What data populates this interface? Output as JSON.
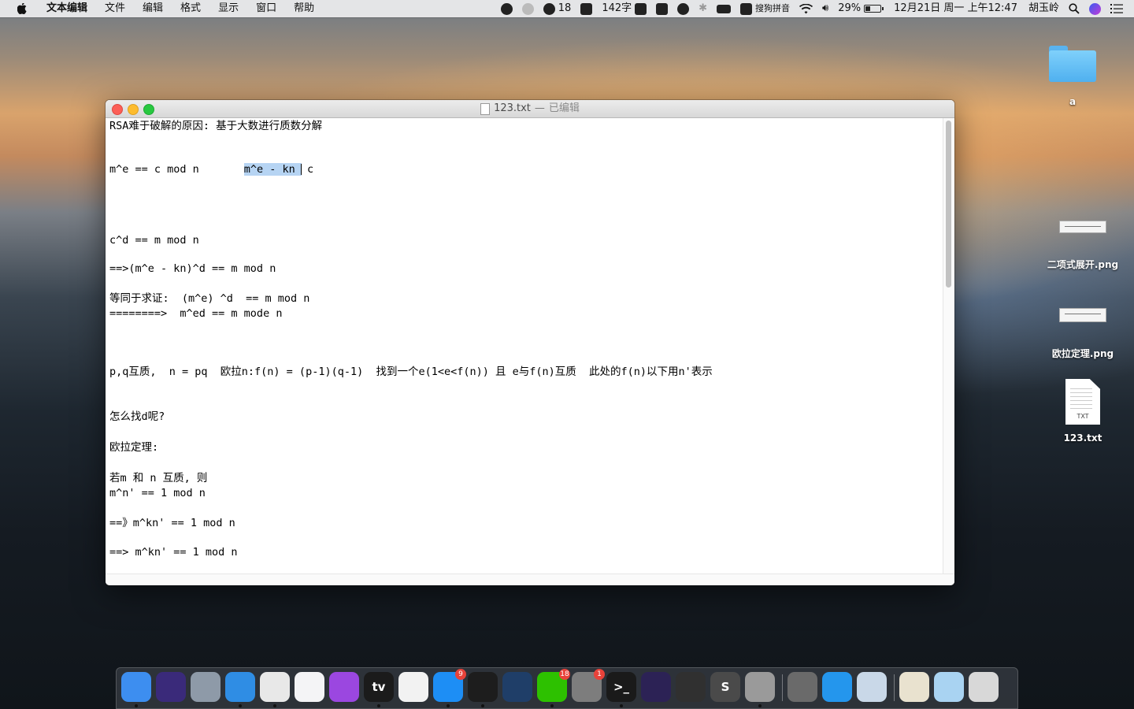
{
  "menubar": {
    "app_name": "文本编辑",
    "menus": [
      "文件",
      "编辑",
      "格式",
      "显示",
      "窗口",
      "帮助"
    ],
    "status": {
      "wechat_count": "18",
      "word_count": "142字",
      "input_method": "搜狗拼音",
      "battery": "29%",
      "datetime": "12月21日 周一 上午12:47",
      "user": "胡玉岭"
    }
  },
  "desktop": {
    "icons": [
      {
        "label": "a",
        "type": "folder-icon"
      },
      {
        "label": "二项式展开.png",
        "type": "image-thumbnail-icon"
      },
      {
        "label": "欧拉定理.png",
        "type": "image-thumbnail-icon"
      },
      {
        "label": "123.txt",
        "type": "text-file-icon",
        "badge": "TXT"
      }
    ]
  },
  "window": {
    "filename": "123.txt",
    "separator": "—",
    "state": "已编辑",
    "lines": [
      {
        "text": "RSA难于破解的原因: 基于大数进行质数分解"
      },
      {
        "pre": "m^e == c mod n       ",
        "selected": "m^e - kn ",
        "post": " c"
      },
      {
        "text": "c^d == m mod n"
      },
      {
        "text": "==>(m^e - kn)^d == m mod n"
      },
      {
        "text": "等同于求证:  (m^e) ^d  == m mod n"
      },
      {
        "text": "========>  m^ed == m mode n"
      },
      {
        "text": "p,q互质,  n = pq  欧拉n:f(n) = (p-1)(q-1)  找到一个e(1<e<f(n)) 且 e与f(n)互质  此处的f(n)以下用n'表示"
      },
      {
        "text": "怎么找d呢?"
      },
      {
        "text": "欧拉定理:"
      },
      {
        "text": "若m 和 n 互质, 则"
      },
      {
        "text": "m^n' == 1 mod n"
      },
      {
        "text": "==》m^kn' == 1 mod n"
      },
      {
        "text": "==> m^kn' == 1 mod n"
      }
    ]
  },
  "dock": {
    "apps": [
      {
        "name": "finder-icon",
        "color": "#3d8ef0"
      },
      {
        "name": "siri-icon",
        "color": "#3a2a7a"
      },
      {
        "name": "launchpad-icon",
        "color": "#8e9aa8"
      },
      {
        "name": "safari-icon",
        "color": "#2f8de4"
      },
      {
        "name": "chrome-icon",
        "color": "#e8e8e8"
      },
      {
        "name": "music-icon",
        "color": "#f4f4f6"
      },
      {
        "name": "podcasts-icon",
        "color": "#9b47e0"
      },
      {
        "name": "apple-tv-icon",
        "color": "#1b1b1b",
        "glyph": "tv"
      },
      {
        "name": "textedit-icon",
        "color": "#f2f2f2"
      },
      {
        "name": "app-store-icon",
        "color": "#1d8ef5",
        "badge": "9"
      },
      {
        "name": "qq-icon",
        "color": "#1d1d1d"
      },
      {
        "name": "quicktime-icon",
        "color": "#1f3e68"
      },
      {
        "name": "wechat-icon",
        "color": "#2dc100",
        "badge": "18"
      },
      {
        "name": "system-preferences-icon",
        "color": "#7d7d7d",
        "badge": "1"
      },
      {
        "name": "terminal-icon",
        "color": "#1a1a1a",
        "glyph": ">_"
      },
      {
        "name": "eclipse-icon",
        "color": "#2c2255"
      },
      {
        "name": "instruments-icon",
        "color": "#303030"
      },
      {
        "name": "sublime-text-icon",
        "color": "#4a4a4a",
        "glyph": "S"
      },
      {
        "name": "keychain-icon",
        "color": "#9a9a9a"
      },
      {
        "name": "calculator-icon",
        "color": "#6a6a6a"
      },
      {
        "name": "docker-icon",
        "color": "#2496ed"
      },
      {
        "name": "preview-icon",
        "color": "#c9d8e8"
      },
      {
        "name": "minimized-window-icon",
        "color": "#e9e2cf"
      },
      {
        "name": "downloads-folder-icon",
        "color": "#a9d3f2"
      },
      {
        "name": "trash-icon",
        "color": "#d8d8d8"
      }
    ]
  }
}
